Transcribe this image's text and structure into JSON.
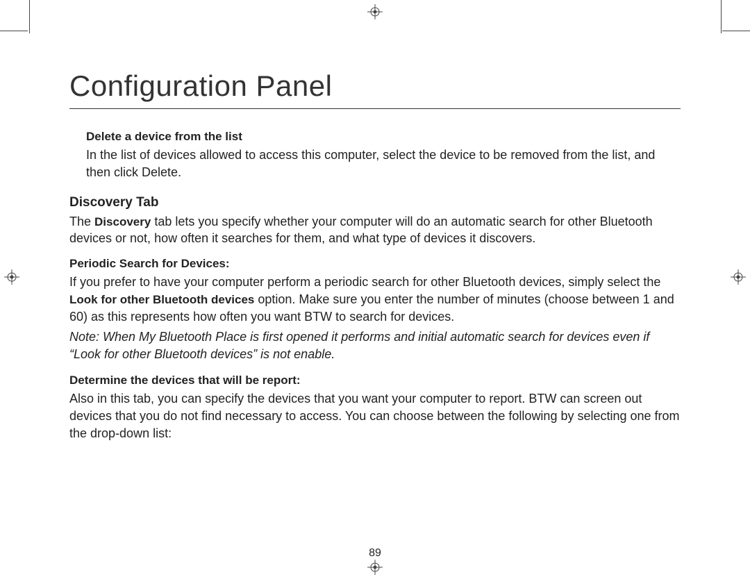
{
  "page_title": "Configuration Panel",
  "sections": {
    "delete": {
      "heading": "Delete a device from the list",
      "text": "In the list of devices allowed to access this computer, select the device to be removed from the list, and then click Delete."
    },
    "discovery": {
      "heading": "Discovery Tab",
      "intro_a": "The ",
      "intro_bold": "Discovery",
      "intro_b": " tab lets you specify whether your computer will do an automatic search for other Bluetooth devices or not, how often it searches for them, and what type of devices it discovers."
    },
    "periodic": {
      "heading": "Periodic Search for Devices:",
      "text_a": "If you prefer to have your computer perform a periodic search for other Bluetooth devices, simply select the ",
      "text_bold": "Look for other Bluetooth devices",
      "text_b": " option. Make sure you enter the number of minutes (choose between 1 and 60) as this represents how often you want BTW to search for devices.",
      "note": "Note: When My Bluetooth Place is first opened it performs and initial automatic search for devices even if “Look for other Bluetooth devices” is not enable."
    },
    "determine": {
      "heading": "Determine the devices that will be report:",
      "text": "Also in this tab, you can specify the devices that you want your computer to report. BTW can screen out devices that you do not find necessary to access. You can choose between the following by selecting one from the drop-down list:"
    }
  },
  "page_number": "89"
}
